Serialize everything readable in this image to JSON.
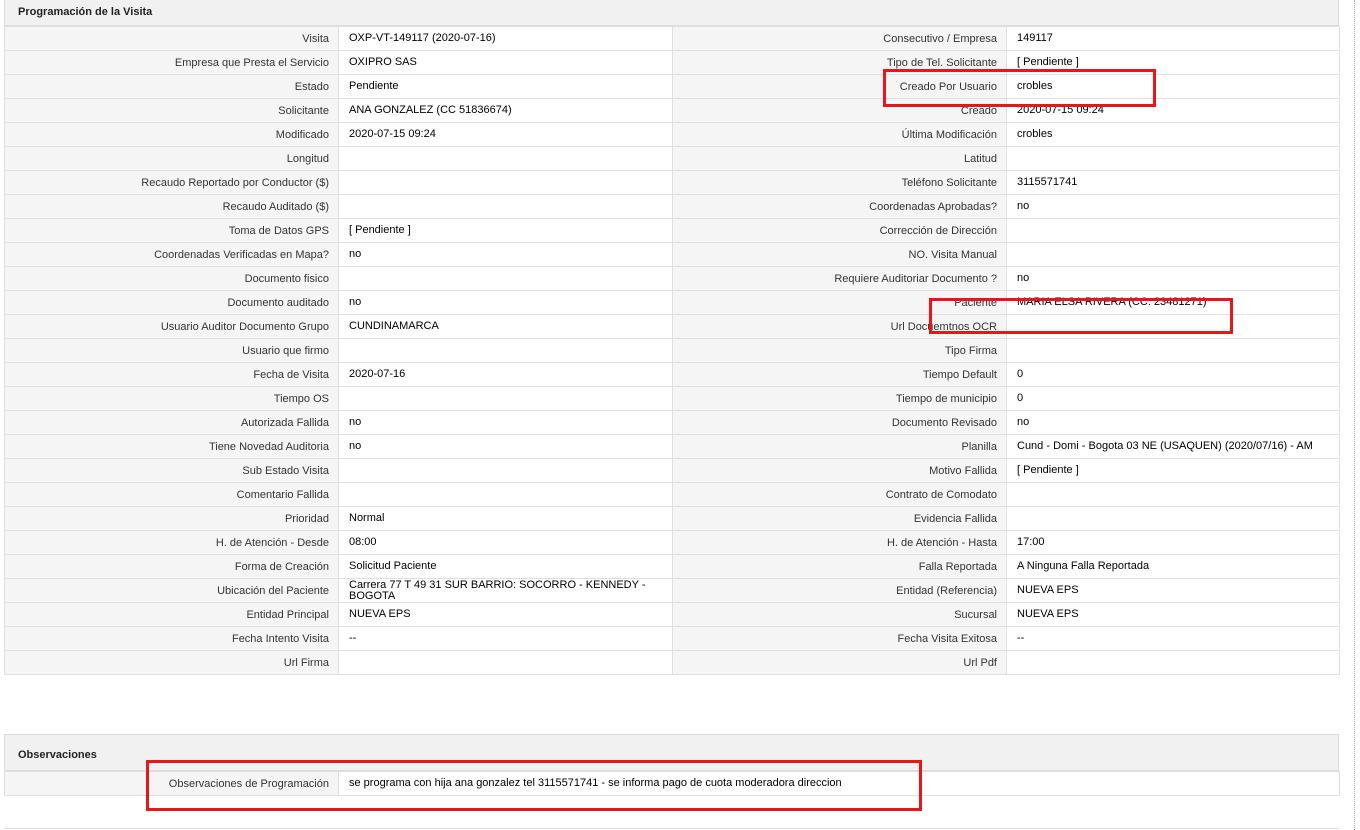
{
  "programacion": {
    "title": "Programación de la Visita",
    "rows": [
      {
        "l1": "Visita",
        "v1": "OXP-VT-149117 (2020-07-16)",
        "l2": "Consecutivo / Empresa",
        "v2": "149117"
      },
      {
        "l1": "Empresa que Presta el Servicio",
        "v1": "OXIPRO SAS",
        "l2": "Tipo de Tel. Solicitante",
        "v2": "[ Pendiente ]"
      },
      {
        "l1": "Estado",
        "v1": "Pendiente",
        "l2": "Creado Por Usuario",
        "v2": "crobles"
      },
      {
        "l1": "Solicitante",
        "v1": "ANA GONZALEZ (CC 51836674)",
        "l2": "Creado",
        "v2": "2020-07-15 09:24"
      },
      {
        "l1": "Modificado",
        "v1": "2020-07-15 09:24",
        "l2": "Última Modificación",
        "v2": " crobles"
      },
      {
        "l1": "Longitud",
        "v1": "",
        "l2": "Latitud",
        "v2": ""
      },
      {
        "l1": "Recaudo Reportado por Conductor ($)",
        "v1": "",
        "l2": "Teléfono Solicitante",
        "v2": "3115571741"
      },
      {
        "l1": "Recaudo Auditado ($)",
        "v1": "",
        "l2": "Coordenadas Aprobadas?",
        "v2": " no"
      },
      {
        "l1": "Toma de Datos GPS",
        "v1": "[ Pendiente ]",
        "l2": "Corrección de Dirección",
        "v2": ""
      },
      {
        "l1": "Coordenadas Verificadas en Mapa?",
        "v1": " no",
        "l2": "NO. Visita Manual",
        "v2": ""
      },
      {
        "l1": "Documento fisico",
        "v1": "",
        "l2": "Requiere Auditoriar Documento ?",
        "v2": " no"
      },
      {
        "l1": "Documento auditado",
        "v1": " no",
        "l2": "Paciente",
        "v2": "MARIA ELSA RIVERA (CC: 23481271)"
      },
      {
        "l1": "Usuario Auditor Documento Grupo",
        "v1": "CUNDINAMARCA",
        "l2": "Url Docuemtnos OCR",
        "v2": ""
      },
      {
        "l1": "Usuario que firmo",
        "v1": "",
        "l2": "Tipo Firma",
        "v2": ""
      },
      {
        "l1": "Fecha de Visita",
        "v1": " 2020-07-16",
        "l2": "Tiempo Default",
        "v2": "0"
      },
      {
        "l1": "Tiempo OS",
        "v1": "",
        "l2": "Tiempo de municipio",
        "v2": "0"
      },
      {
        "l1": "Autorizada Fallida",
        "v1": " no",
        "l2": "Documento Revisado",
        "v2": " no"
      },
      {
        "l1": "Tiene Novedad Auditoria",
        "v1": " no",
        "l2": "Planilla",
        "v2": "Cund - Domi - Bogota 03 NE (USAQUEN) (2020/07/16) - AM"
      },
      {
        "l1": "Sub Estado Visita",
        "v1": "",
        "l2": "Motivo Fallida",
        "v2": "[ Pendiente ]"
      },
      {
        "l1": "Comentario Fallida",
        "v1": "",
        "l2": "Contrato de Comodato",
        "v2": ""
      },
      {
        "l1": "Prioridad",
        "v1": "Normal",
        "l2": "Evidencia Fallida",
        "v2": ""
      },
      {
        "l1": "H. de Atención - Desde",
        "v1": "08:00",
        "l2": "H. de Atención - Hasta",
        "v2": "17:00"
      },
      {
        "l1": "Forma de Creación",
        "v1": "Solicitud Paciente",
        "l2": "Falla Reportada",
        "v2": "A Ninguna Falla Reportada"
      },
      {
        "l1": "Ubicación del Paciente",
        "v1": "Carrera 77 T 49 31 SUR BARRIO: SOCORRO - KENNEDY - BOGOTA",
        "l2": "Entidad (Referencia)",
        "v2": "NUEVA EPS"
      },
      {
        "l1": "Entidad Principal",
        "v1": "NUEVA EPS",
        "l2": "Sucursal",
        "v2": "NUEVA EPS"
      },
      {
        "l1": "Fecha Intento Visita",
        "v1": " --",
        "l2": "Fecha Visita Exitosa",
        "v2": " --"
      },
      {
        "l1": "Url Firma",
        "v1": "",
        "l2": "Url Pdf",
        "v2": ""
      }
    ]
  },
  "observaciones": {
    "title": "Observaciones",
    "label": "Observaciones de Programación",
    "value": " se programa con hija ana gonzalez tel 3115571741 - se informa pago de cuota moderadora direccion"
  },
  "colors": {
    "highlight": "#e8151b",
    "label_bg": "#f5f5f5",
    "header_bg": "#f1f1f1",
    "border": "#dfdfdf"
  }
}
